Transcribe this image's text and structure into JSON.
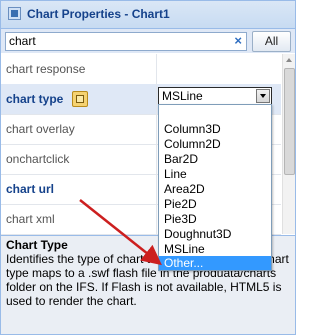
{
  "window": {
    "title": "Chart Properties - Chart1"
  },
  "search": {
    "value": "chart",
    "clear_icon": "×",
    "all_label": "All"
  },
  "properties": [
    {
      "name": "chart response",
      "bold": false
    },
    {
      "name": "chart type",
      "bold": true
    },
    {
      "name": "chart overlay",
      "bold": false
    },
    {
      "name": "onchartclick",
      "bold": false
    },
    {
      "name": "chart url",
      "bold": true
    },
    {
      "name": "chart xml",
      "bold": false
    }
  ],
  "chart_type_select": {
    "value": "MSLine"
  },
  "dropdown_options": [
    "",
    "Column3D",
    "Column2D",
    "Bar2D",
    "Line",
    "Area2D",
    "Pie2D",
    "Pie3D",
    "Doughnut3D",
    "MSLine",
    "Other..."
  ],
  "highlighted_option": "Other...",
  "description": {
    "title": "Chart Type",
    "text": "Identifies the type of chart to be rendered. Each chart type maps to a .swf flash file in the produata/charts folder on the IFS. If Flash is not available, HTML5 is used to render the chart."
  },
  "colors": {
    "title_text": "#15428b",
    "highlight": "#3399ff",
    "arrow": "#cc1f1f"
  },
  "icons": {
    "title": "gear-icon",
    "help": "help-icon"
  }
}
